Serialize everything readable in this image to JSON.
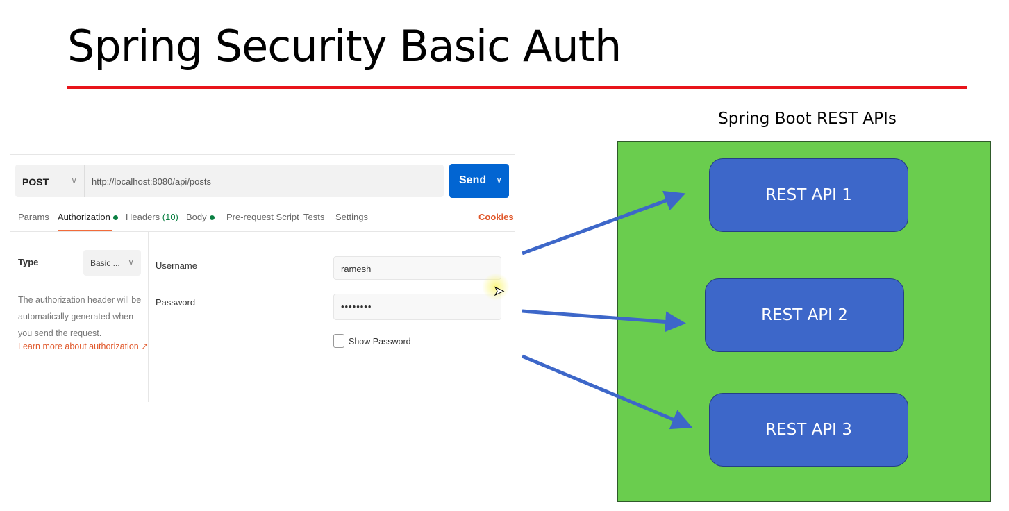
{
  "slide": {
    "title": "Spring Security Basic Auth",
    "diagram_title": "Spring Boot REST APIs",
    "apis": [
      "REST API 1",
      "REST API 2",
      "REST API 3"
    ],
    "colors": {
      "accent_line": "#e8141a",
      "container": "#6acd4e",
      "api_box": "#3d67c9"
    }
  },
  "postman": {
    "method": "POST",
    "url": "http://localhost:8080/api/posts",
    "send": "Send",
    "tabs": {
      "params": "Params",
      "authorization": "Authorization",
      "headers": "Headers",
      "headers_count": "(10)",
      "body": "Body",
      "prerequest": "Pre-request Script",
      "tests": "Tests",
      "settings": "Settings",
      "cookies": "Cookies"
    },
    "auth": {
      "type_label": "Type",
      "type_value": "Basic ...",
      "description": "The authorization header will be automatically generated when you send the request.",
      "learn_more": "Learn more about authorization ↗",
      "username_label": "Username",
      "username_value": "ramesh",
      "password_label": "Password",
      "password_value": "••••••••",
      "show_password": "Show Password"
    }
  }
}
